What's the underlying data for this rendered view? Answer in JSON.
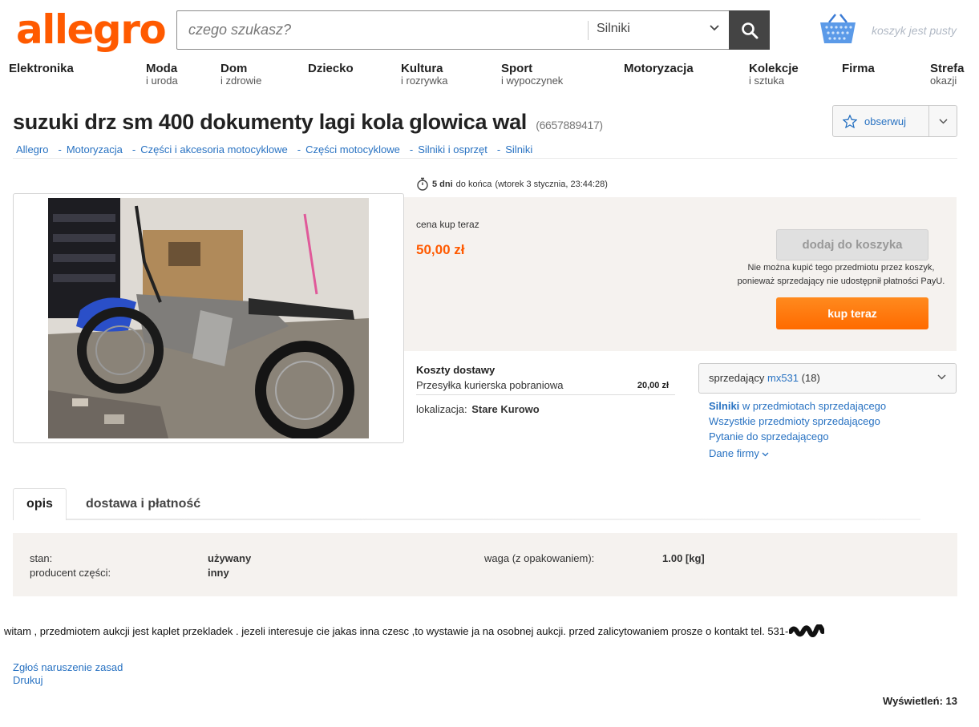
{
  "header": {
    "logo": "allegro",
    "search_placeholder": "czego szukasz?",
    "search_category": "Silniki",
    "cart_text": "koszyk jest pusty"
  },
  "nav": [
    {
      "main": "Elektronika",
      "sub": ""
    },
    {
      "main": "Moda",
      "sub": "i uroda"
    },
    {
      "main": "Dom",
      "sub": "i zdrowie"
    },
    {
      "main": "Dziecko",
      "sub": ""
    },
    {
      "main": "Kultura",
      "sub": "i rozrywka"
    },
    {
      "main": "Sport",
      "sub": "i wypoczynek"
    },
    {
      "main": "Motoryzacja",
      "sub": ""
    },
    {
      "main": "Kolekcje",
      "sub": "i sztuka"
    },
    {
      "main": "Firma",
      "sub": ""
    },
    {
      "main": "Strefa",
      "sub": "okazji"
    }
  ],
  "offer": {
    "title": "suzuki drz sm 400 dokumenty lagi kola glowica wal",
    "id": "(6657889417)",
    "watch_label": "obserwuj"
  },
  "breadcrumb": [
    "Allegro",
    "Motoryzacja",
    "Części i akcesoria motocyklowe",
    "Części motocyklowe",
    "Silniki i osprzęt",
    "Silniki"
  ],
  "time": {
    "remaining": "5 dni",
    "suffix": "do końca",
    "end": "(wtorek 3 stycznia, 23:44:28)"
  },
  "price": {
    "label": "cena kup teraz",
    "value": "50,00 zł",
    "add_to_cart": "dodaj do koszyka",
    "cart_note_1": "Nie można kupić tego przedmiotu przez koszyk,",
    "cart_note_2": "ponieważ sprzedający nie udostępnił płatności PayU.",
    "buy_now": "kup teraz"
  },
  "delivery": {
    "title": "Koszty dostawy",
    "method": "Przesyłka kurierska pobraniowa",
    "cost": "20,00 zł",
    "location_label": "lokalizacja:",
    "location": "Stare Kurowo"
  },
  "seller": {
    "label": "sprzedający",
    "name": "mx531",
    "rating": "(18)",
    "link_category": "Silniki",
    "link_category_rest": "w przedmiotach sprzedającego",
    "link_all": "Wszystkie przedmioty sprzedającego",
    "link_ask": "Pytanie do sprzedającego",
    "link_company": "Dane firmy"
  },
  "tabs": {
    "active": "opis",
    "other": "dostawa i płatność"
  },
  "params": {
    "stan_label": "stan:",
    "stan_value": "używany",
    "producent_label": "producent części:",
    "producent_value": "inny",
    "waga_label": "waga (z opakowaniem):",
    "waga_value": "1.00 [kg]"
  },
  "description": "witam , przedmiotem aukcji jest kaplet przekladek . jezeli interesuje cie jakas inna czesc ,to wystawie ja na osobnej aukcji. przed zalicytowaniem prosze o kontakt tel. 531-",
  "footer": {
    "report": "Zgłoś naruszenie zasad",
    "print": "Drukuj",
    "views": "Wyświetleń: 13"
  },
  "colors": {
    "brand": "#ff5a00",
    "link": "#2872c2",
    "panel": "#f5f2ef"
  }
}
